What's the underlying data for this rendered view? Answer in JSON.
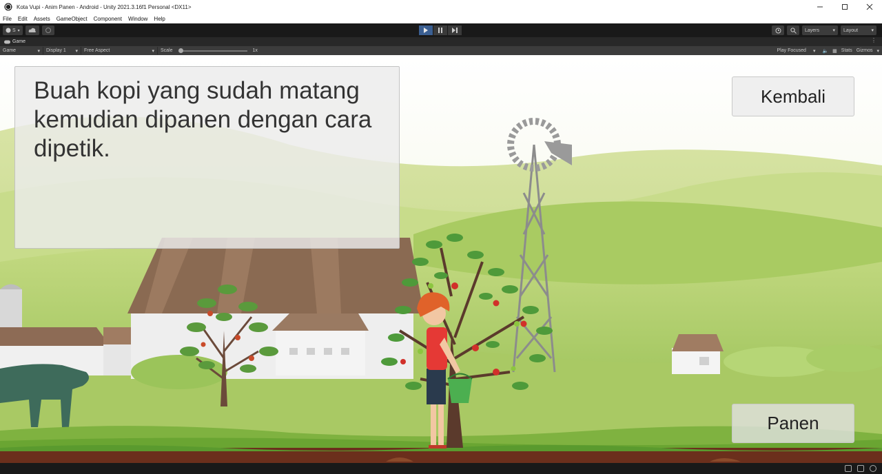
{
  "window": {
    "title": "Kota Vupi - Anim Panen - Android - Unity 2021.3.16f1 Personal <DX11>"
  },
  "menu": [
    "File",
    "Edit",
    "Assets",
    "GameObject",
    "Component",
    "Window",
    "Help"
  ],
  "toolbar": {
    "account_label": "S",
    "layers_label": "Layers",
    "layout_label": "Layout"
  },
  "tab": {
    "label": "Game"
  },
  "game_controls": {
    "mode": "Game",
    "display": "Display 1",
    "aspect": "Free Aspect",
    "scale_label": "Scale",
    "scale_value": "1x",
    "play_focused": "Play Focused",
    "stats": "Stats",
    "gizmos": "Gizmos"
  },
  "game": {
    "narration": "Buah kopi yang sudah matang kemudian dipanen dengan cara dipetik.",
    "back_button": "Kembali",
    "harvest_button": "Panen"
  },
  "colors": {
    "editor_dark": "#191919",
    "play_active": "#3b5f92",
    "sky": "#f4f6ea",
    "grass_light": "#b8d16a",
    "grass_dark": "#7fb240",
    "soil": "#6b2f1c"
  }
}
